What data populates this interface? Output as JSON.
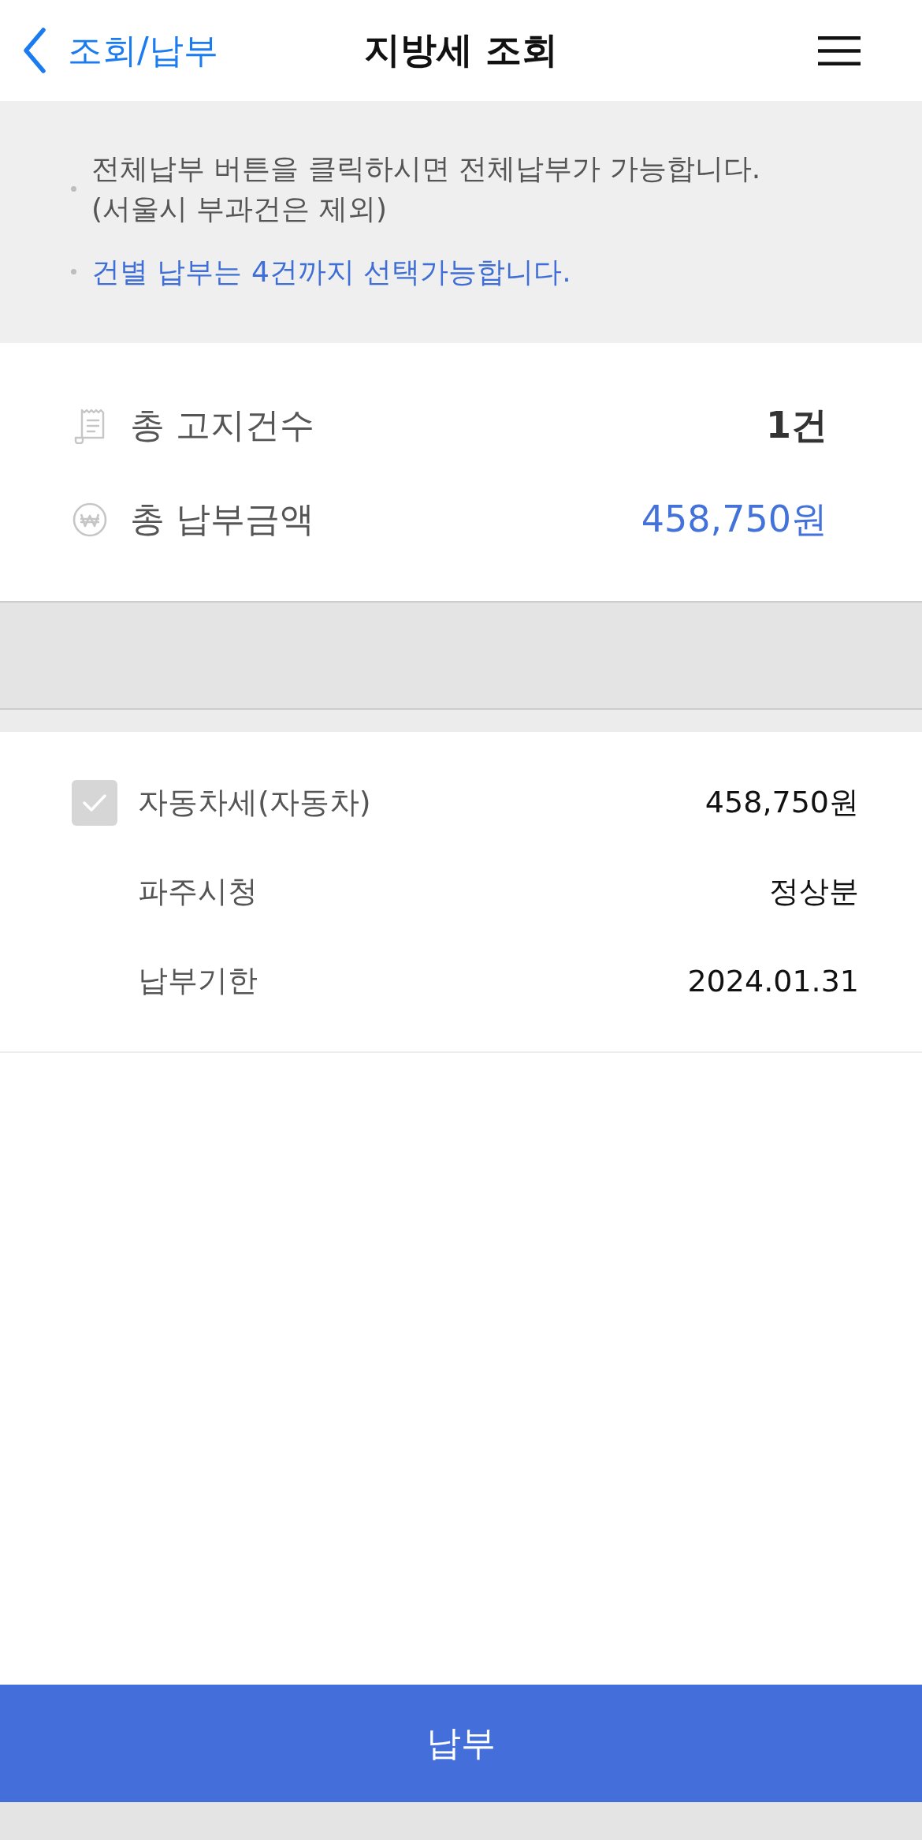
{
  "header": {
    "back_label": "조회/납부",
    "title": "지방세 조회"
  },
  "notices": [
    {
      "text": "전체납부 버튼을 클릭하시면 전체납부가 가능합니다.\n(서울시 부과건은 제외)",
      "highlighted": false
    },
    {
      "text": "건별 납부는 4건까지 선택가능합니다.",
      "highlighted": true
    }
  ],
  "summary": [
    {
      "kind": "count",
      "label": "총 고지건수",
      "value": "1건"
    },
    {
      "kind": "amount",
      "label": "총 납부금액",
      "value": "458,750원"
    }
  ],
  "bills": [
    {
      "title": "자동차세(자동차)",
      "amount": "458,750원",
      "checked": true,
      "details": [
        {
          "label": "파주시청",
          "value": "정상분"
        },
        {
          "label": "납부기한",
          "value": "2024.01.31"
        }
      ]
    }
  ],
  "pay_button": "납부"
}
